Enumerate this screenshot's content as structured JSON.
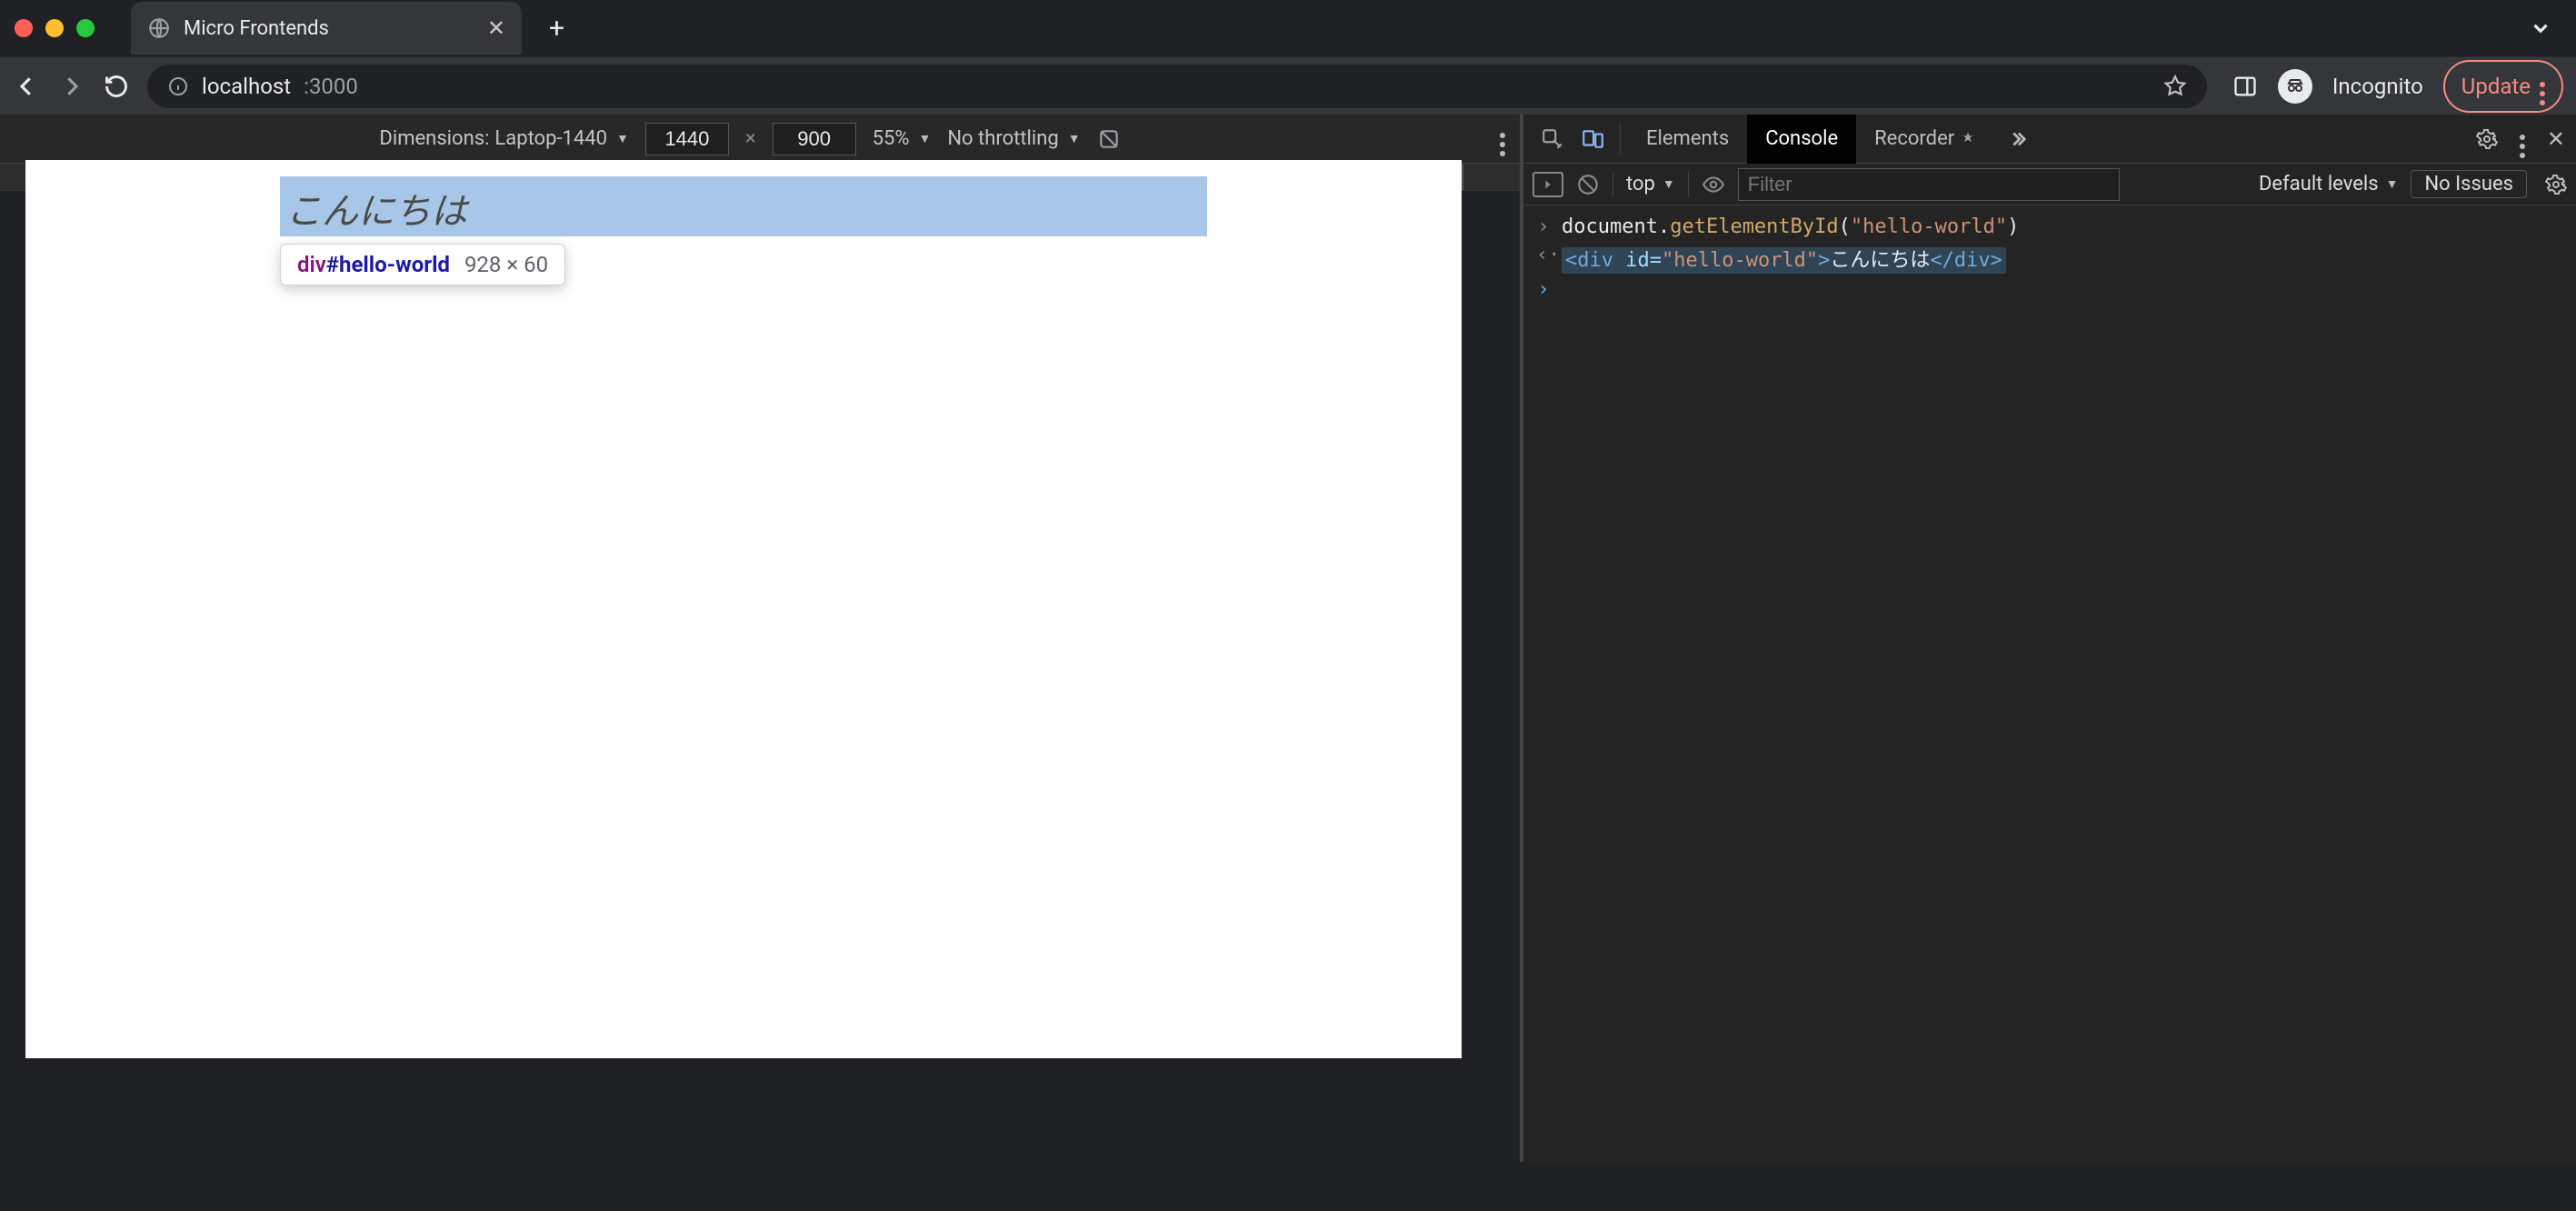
{
  "browser": {
    "tab_title": "Micro Frontends",
    "url_host": "localhost",
    "url_port": ":3000",
    "incognito_label": "Incognito",
    "update_label": "Update"
  },
  "deviceBar": {
    "dimensions_label": "Dimensions:",
    "device_name": "Laptop-1440",
    "width": "1440",
    "height": "900",
    "zoom": "55%",
    "throttling": "No throttling"
  },
  "page": {
    "hello_text": "こんにちは",
    "tooltip_tag": "div",
    "tooltip_id": "#hello-world",
    "tooltip_dims": "928 × 60"
  },
  "devtools": {
    "tabs": {
      "elements": "Elements",
      "console": "Console",
      "recorder": "Recorder"
    },
    "console_toolbar": {
      "context": "top",
      "filter_placeholder": "Filter",
      "levels": "Default levels",
      "no_issues": "No Issues"
    },
    "console": {
      "input_parts": {
        "obj": "document",
        "dot": ".",
        "fn": "getElementById",
        "open": "(",
        "str": "\"hello-world\"",
        "close": ")"
      },
      "output_parts": {
        "open_tag": "<div",
        "sp": " ",
        "attr": "id=",
        "val": "\"hello-world\"",
        "gt": ">",
        "text": "こんにちは",
        "close_tag": "</div>"
      }
    }
  }
}
